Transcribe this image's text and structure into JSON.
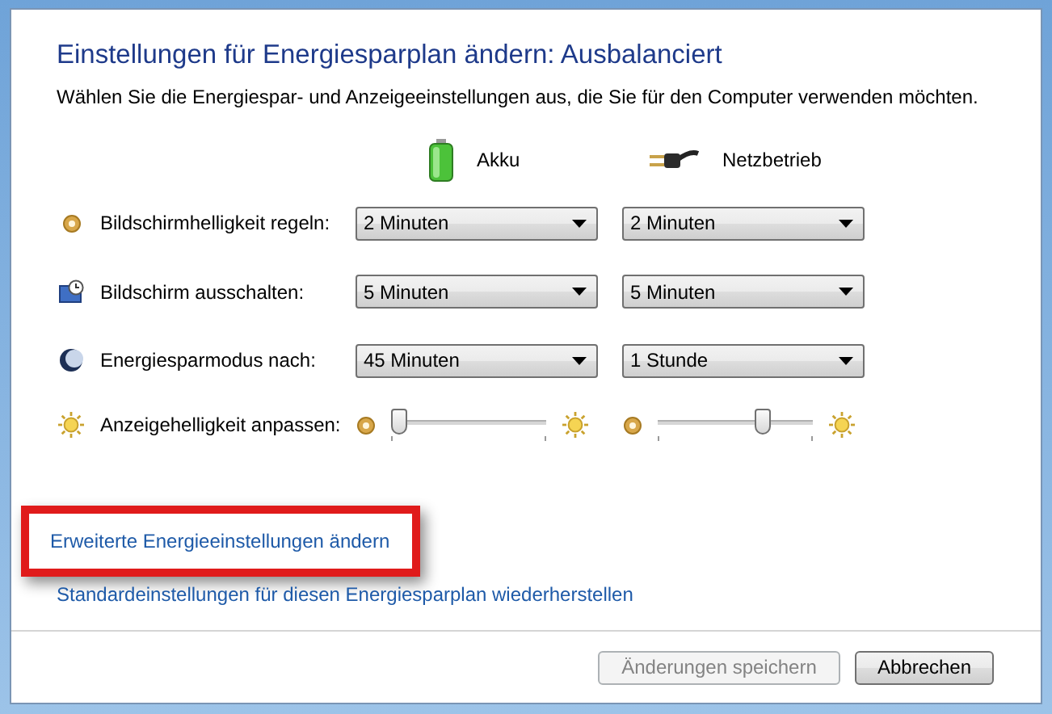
{
  "heading": "Einstellungen für Energiesparplan ändern: Ausbalanciert",
  "description": "Wählen Sie die Energiespar- und Anzeigeeinstellungen aus, die Sie für den Computer verwenden möchten.",
  "columns": [
    {
      "kind": "battery",
      "label": "Akku"
    },
    {
      "kind": "plug",
      "label": "Netzbetrieb"
    }
  ],
  "settings": [
    {
      "kind": "dropdown",
      "label": "Bildschirmhelligkeit regeln:",
      "values": [
        "2 Minuten",
        "2 Minuten"
      ]
    },
    {
      "kind": "dropdown",
      "label": "Bildschirm ausschalten:",
      "values": [
        "5 Minuten",
        "5 Minuten"
      ]
    },
    {
      "kind": "dropdown",
      "label": "Energiesparmodus nach:",
      "values": [
        "45 Minuten",
        "1 Stunde"
      ]
    },
    {
      "kind": "slider",
      "label": "Anzeigehelligkeit anpassen:",
      "levels": [
        {
          "level": 0.05
        },
        {
          "level": 0.68
        }
      ]
    }
  ],
  "links": [
    {
      "label": "Erweiterte Energieeinstellungen ändern",
      "highlighted": true
    },
    {
      "label": "Standardeinstellungen für diesen Energiesparplan wiederherstellen",
      "highlighted": false
    }
  ],
  "buttons": [
    {
      "label": "Änderungen speichern",
      "disabled": true
    },
    {
      "label": "Abbrechen",
      "disabled": false
    }
  ]
}
